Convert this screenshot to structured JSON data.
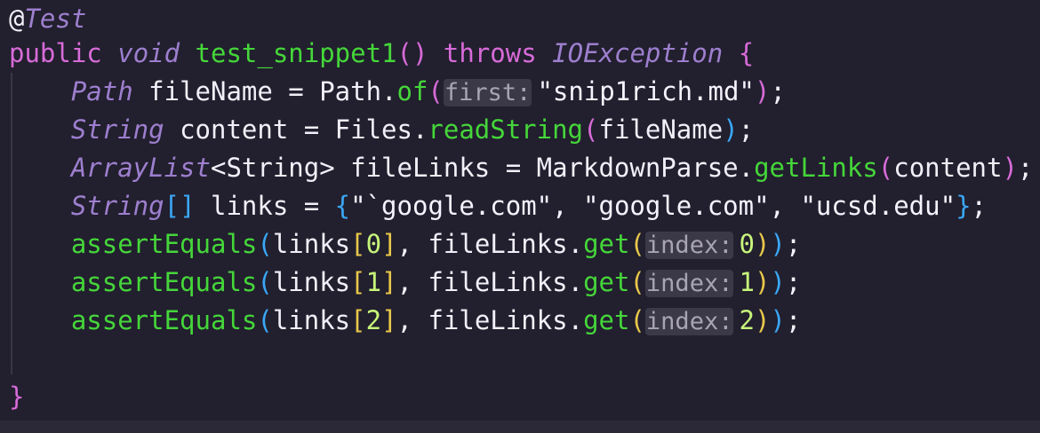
{
  "theme": {
    "background": "#221f2e",
    "default": "#f1eff8",
    "keyword": "#d76bd8",
    "type": "#9d7fce",
    "function": "#45d63a",
    "string": "#f6f3ff",
    "number": "#c7f57a",
    "paren_outer": "#e9c84a",
    "paren_inner": "#d76bd8",
    "paren_blue": "#3aa7f5",
    "annotation_at": "#f1eff8",
    "hint_bg": "#3b3847",
    "hint_text": "#a8a4b4"
  },
  "code": [
    [
      {
        "t": "@",
        "c": "default"
      },
      {
        "t": "Test",
        "c": "type",
        "i": true
      }
    ],
    [
      {
        "t": "public",
        "c": "keyword"
      },
      {
        "t": " "
      },
      {
        "t": "void",
        "c": "type",
        "i": true
      },
      {
        "t": " "
      },
      {
        "t": "test_snippet1",
        "c": "function"
      },
      {
        "t": "()",
        "c": "keyword"
      },
      {
        "t": " "
      },
      {
        "t": "throws",
        "c": "keyword"
      },
      {
        "t": " "
      },
      {
        "t": "IOException",
        "c": "type",
        "i": true
      },
      {
        "t": " "
      },
      {
        "t": "{",
        "c": "keyword"
      }
    ],
    [
      {
        "t": "    "
      },
      {
        "t": "Path",
        "c": "type",
        "i": true
      },
      {
        "t": " fileName = Path."
      },
      {
        "t": "of",
        "c": "function"
      },
      {
        "t": "(",
        "c": "keyword"
      },
      {
        "t": "first:",
        "hint": true
      },
      {
        "t": "\"snip1rich.md\"",
        "c": "string"
      },
      {
        "t": ")",
        "c": "keyword"
      },
      {
        "t": ";"
      }
    ],
    [
      {
        "t": "    "
      },
      {
        "t": "String",
        "c": "type",
        "i": true
      },
      {
        "t": " content = Files."
      },
      {
        "t": "readString",
        "c": "function"
      },
      {
        "t": "(",
        "c": "keyword"
      },
      {
        "t": "fileName"
      },
      {
        "t": ")",
        "c": "paren_blue"
      },
      {
        "t": ";"
      }
    ],
    [
      {
        "t": "    "
      },
      {
        "t": "ArrayList",
        "c": "type",
        "i": true
      },
      {
        "t": "<String> fileLinks = MarkdownParse."
      },
      {
        "t": "getLinks",
        "c": "function"
      },
      {
        "t": "(",
        "c": "keyword"
      },
      {
        "t": "content"
      },
      {
        "t": ")",
        "c": "keyword"
      },
      {
        "t": ";"
      }
    ],
    [
      {
        "t": "    "
      },
      {
        "t": "String",
        "c": "type",
        "i": true
      },
      {
        "t": "[]",
        "c": "paren_blue"
      },
      {
        "t": " links = "
      },
      {
        "t": "{",
        "c": "paren_blue"
      },
      {
        "t": "\"`google.com\", \"google.com\", \"ucsd.edu\"",
        "c": "string"
      },
      {
        "t": "}",
        "c": "paren_blue"
      },
      {
        "t": ";"
      }
    ],
    [
      {
        "t": "    "
      },
      {
        "t": "assertEquals",
        "c": "function"
      },
      {
        "t": "(",
        "c": "paren_blue"
      },
      {
        "t": "links"
      },
      {
        "t": "[",
        "c": "paren_outer"
      },
      {
        "t": "0",
        "c": "number"
      },
      {
        "t": "]",
        "c": "paren_outer"
      },
      {
        "t": ", fileLinks."
      },
      {
        "t": "get",
        "c": "function"
      },
      {
        "t": "(",
        "c": "paren_outer"
      },
      {
        "t": "index:",
        "hint": true
      },
      {
        "t": "0",
        "c": "number"
      },
      {
        "t": ")",
        "c": "paren_outer"
      },
      {
        "t": ")",
        "c": "paren_blue"
      },
      {
        "t": ";"
      }
    ],
    [
      {
        "t": "    "
      },
      {
        "t": "assertEquals",
        "c": "function"
      },
      {
        "t": "(",
        "c": "paren_blue"
      },
      {
        "t": "links"
      },
      {
        "t": "[",
        "c": "paren_outer"
      },
      {
        "t": "1",
        "c": "number"
      },
      {
        "t": "]",
        "c": "paren_outer"
      },
      {
        "t": ", fileLinks."
      },
      {
        "t": "get",
        "c": "function"
      },
      {
        "t": "(",
        "c": "paren_outer"
      },
      {
        "t": "index:",
        "hint": true
      },
      {
        "t": "1",
        "c": "number"
      },
      {
        "t": ")",
        "c": "paren_outer"
      },
      {
        "t": ")",
        "c": "paren_blue"
      },
      {
        "t": ";"
      }
    ],
    [
      {
        "t": "    "
      },
      {
        "t": "assertEquals",
        "c": "function"
      },
      {
        "t": "(",
        "c": "paren_blue"
      },
      {
        "t": "links"
      },
      {
        "t": "[",
        "c": "paren_outer"
      },
      {
        "t": "2",
        "c": "number"
      },
      {
        "t": "]",
        "c": "paren_outer"
      },
      {
        "t": ", fileLinks."
      },
      {
        "t": "get",
        "c": "function"
      },
      {
        "t": "(",
        "c": "paren_outer"
      },
      {
        "t": "index:",
        "hint": true
      },
      {
        "t": "2",
        "c": "number"
      },
      {
        "t": ")",
        "c": "paren_outer"
      },
      {
        "t": ")",
        "c": "paren_blue"
      },
      {
        "t": ";"
      }
    ],
    [],
    [
      {
        "t": "}",
        "c": "keyword"
      }
    ]
  ]
}
